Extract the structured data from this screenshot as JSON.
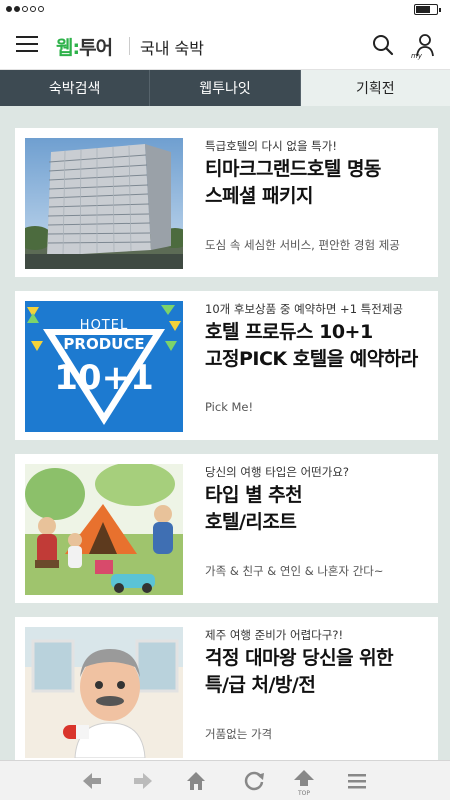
{
  "header": {
    "logo_brand": "웹",
    "logo_sep": ":",
    "logo_text": "투어",
    "page_title": "국내 숙박"
  },
  "tabs": [
    {
      "label": "숙박검색",
      "active": false
    },
    {
      "label": "웹투나잇",
      "active": false
    },
    {
      "label": "기획전",
      "active": true
    }
  ],
  "promotions": [
    {
      "subtitle": "특급호텔의 다시 없을 특가!",
      "title_line1": "티마크그랜드호텔 명동",
      "title_line2": "스페셜 패키지",
      "description": "도심 속 세심한 서비스, 편안한 경험 제공",
      "image": "hotel-building-photo"
    },
    {
      "subtitle": "10개 후보상품 중 예약하면 +1 특전제공",
      "title_line1": "호텔 프로듀스 10+1",
      "title_line2": "고정PICK 호텔을 예약하라",
      "description": "Pick Me!",
      "image": "hotel-produce-logo",
      "image_text": {
        "line1": "HOTEL",
        "line2": "PRODUCE",
        "line3": "10+1"
      }
    },
    {
      "subtitle": "당신의 여행 타입은 어떤가요?",
      "title_line1": "타입 별 추천",
      "title_line2": "호텔/리조트",
      "description": "가족 & 친구 & 연인 & 나혼자 간다~",
      "image": "family-camping-illustration"
    },
    {
      "subtitle": "제주 여행 준비가 어렵다구?!",
      "title_line1": "걱정 대마왕 당신을 위한",
      "title_line2": "특/급 처/방/전",
      "description": "거품없는 가격",
      "image": "doctor-cartoon-illustration"
    }
  ],
  "bottom_nav": {
    "top_label": "TOP",
    "icons": [
      "back-arrow-icon",
      "forward-arrow-icon",
      "home-icon",
      "refresh-icon",
      "top-icon",
      "menu-icon"
    ]
  },
  "colors": {
    "brand_green": "#2eb24a",
    "tab_dark": "#3d4a52",
    "tab_active": "#eaf0ee",
    "page_bg": "#dde6e3"
  }
}
